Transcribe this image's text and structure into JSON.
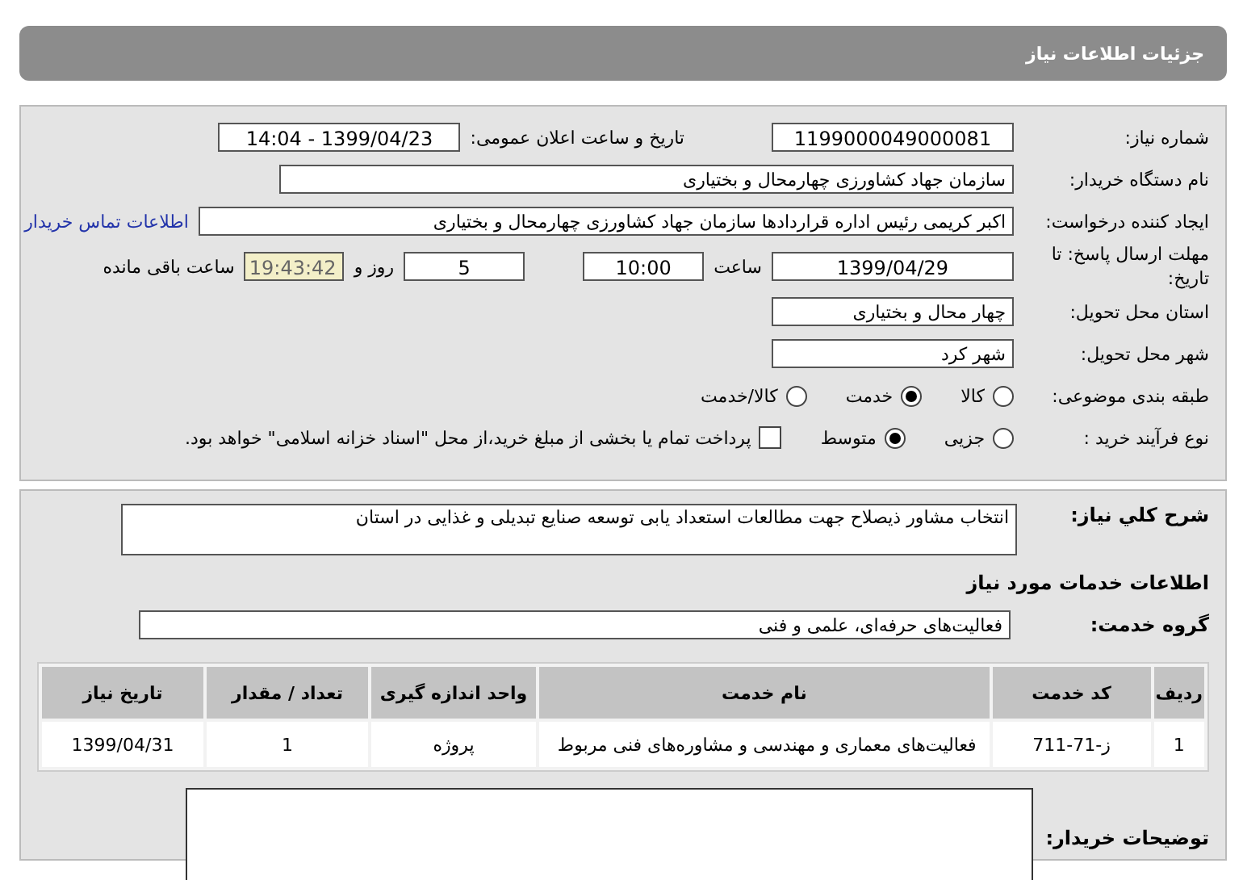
{
  "header": {
    "title": "جزئیات اطلاعات نیاز"
  },
  "need_number": {
    "label": "شماره نیاز:",
    "value": "1199000049000081"
  },
  "announce": {
    "label": "تاریخ و ساعت اعلان عمومی:",
    "value": "1399/04/23 - 14:04"
  },
  "buyer_org": {
    "label": "نام دستگاه خریدار:",
    "value": "سازمان جهاد کشاورزی چهارمحال و بختیاری"
  },
  "requester": {
    "label": "ایجاد کننده درخواست:",
    "value": "اکبر کریمی رئیس اداره قراردادها سازمان جهاد کشاورزی چهارمحال و بختیاری",
    "link": "اطلاعات تماس خریدار"
  },
  "deadline": {
    "label": "مهلت ارسال پاسخ: تا تاریخ:",
    "date": "1399/04/29",
    "time_label": "ساعت",
    "time": "10:00",
    "days": "5",
    "days_label": "روز و",
    "remaining": "19:43:42",
    "remaining_label": "ساعت باقی مانده"
  },
  "province": {
    "label": "استان محل تحویل:",
    "value": "چهار محال و بختیاری"
  },
  "city": {
    "label": "شهر محل تحویل:",
    "value": "شهر کرد"
  },
  "category": {
    "label": "طبقه بندی موضوعی:",
    "options": [
      {
        "label": "کالا",
        "selected": false
      },
      {
        "label": "خدمت",
        "selected": true
      },
      {
        "label": "کالا/خدمت",
        "selected": false
      }
    ]
  },
  "process": {
    "label": "نوع فرآیند خرید :",
    "options": [
      {
        "label": "جزیی",
        "selected": false
      },
      {
        "label": "متوسط",
        "selected": true
      }
    ],
    "payment": {
      "checked": false,
      "text": "پرداخت تمام یا بخشی از مبلغ خرید،از محل \"اسناد خزانه اسلامی\" خواهد بود."
    }
  },
  "description": {
    "label": "شرح كلي نياز:",
    "value": "انتخاب مشاور ذیصلاح جهت مطالعات استعداد یابی توسعه صنایع تبدیلی و غذایی در استان"
  },
  "services": {
    "title": "اطلاعات خدمات مورد نیاز",
    "group_label": "گروه خدمت:",
    "group": "فعالیت‌های حرفه‌ای، علمی و فنی",
    "table": {
      "columns": [
        "ردیف",
        "کد خدمت",
        "نام خدمت",
        "واحد اندازه گیری",
        "تعداد / مقدار",
        "تاریخ نیاز"
      ],
      "rows": [
        [
          "1",
          "ز-71-711",
          "فعالیت‌های معماری و مهندسی و مشاوره‌های فنی مربوط",
          "پروژه",
          "1",
          "1399/04/31"
        ]
      ]
    }
  },
  "buyer_notes": {
    "label": "توضیحات خریدار:"
  }
}
